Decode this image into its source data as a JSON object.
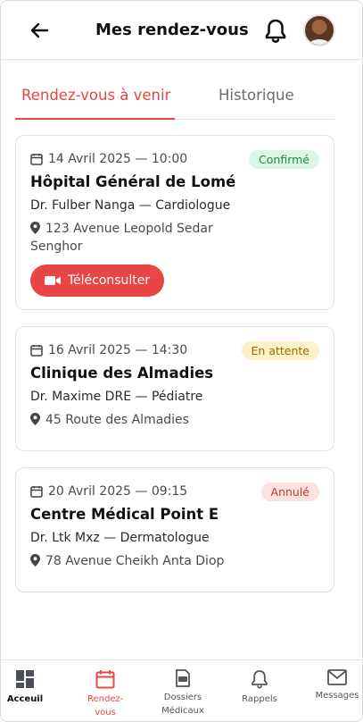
{
  "header": {
    "title": "Mes rendez-vous",
    "back_icon": "arrow-left-icon",
    "notifications_icon": "bell-icon",
    "avatar": "user-avatar"
  },
  "tabs": [
    {
      "label": "Rendez-vous à venir",
      "active": true
    },
    {
      "label": "Historique",
      "active": false
    }
  ],
  "appointments": [
    {
      "date": "14 Avril 2025 — 10:00",
      "status": "Confirmé",
      "status_color": "#1f8a4c",
      "place": "Hôpital Général de Lomé",
      "doctor": "Dr. Fulber Nanga — Cardiologue",
      "address": "123 Avenue Leopold Sedar Senghor",
      "action_label": "Téléconsulter"
    },
    {
      "date": "16 Avril 2025 — 14:30",
      "status": "En attente",
      "status_color": "#9a6b00",
      "place": "Clinique des Almadies",
      "doctor": "Dr. Maxime DRE — Pédiatre",
      "address": "45 Route des Almadies"
    },
    {
      "date": "20 Avril 2025 — 09:15",
      "status": "Annulé",
      "status_color": "#c0392b",
      "place": "Centre Médical Point E",
      "doctor": "Dr. Ltk Mxz — Dermatologue",
      "address": "78 Avenue Cheikh Anta Diop"
    }
  ],
  "bottom_nav": [
    {
      "label": "Acceuil",
      "icon": "dashboard-icon"
    },
    {
      "label": "Rendez-vous",
      "icon": "calendar-icon",
      "active": true
    },
    {
      "label": "Dossiers Médicaux",
      "icon": "medical-file-icon"
    },
    {
      "label": "Rappels",
      "icon": "bell-icon"
    },
    {
      "label": "Messages",
      "icon": "mail-icon"
    }
  ],
  "colors": {
    "accent": "#e84545",
    "confirmed_bg": "#dcf5e6",
    "pending_bg": "#fdf1c7",
    "cancelled_bg": "#fde2e2"
  }
}
